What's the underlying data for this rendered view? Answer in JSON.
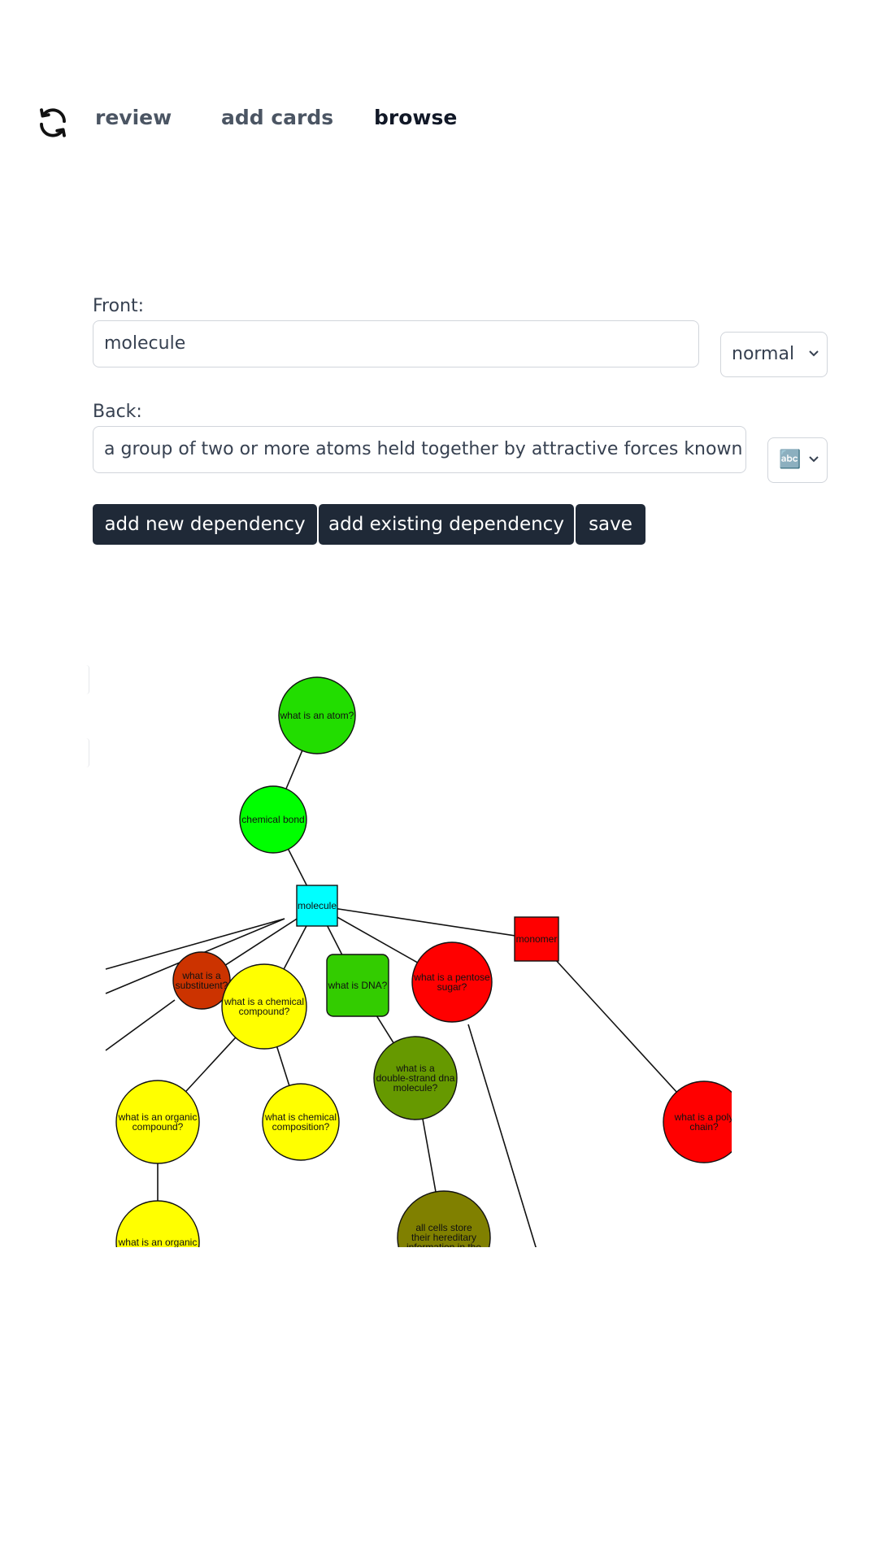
{
  "nav": {
    "refresh_icon": "refresh-icon",
    "links": [
      {
        "label": "review",
        "active": false
      },
      {
        "label": "add cards",
        "active": false
      },
      {
        "label": "browse",
        "active": true
      }
    ]
  },
  "editor": {
    "front_label": "Front:",
    "front_value": "molecule",
    "front_mode": "normal",
    "back_label": "Back:",
    "back_value": "a group of two or more atoms held together by attractive forces known as chemical bonds",
    "back_mode_icon": "🔤"
  },
  "actions": {
    "add_new_dependency": "add new dependency",
    "add_existing_dependency": "add existing dependency",
    "save": "save"
  },
  "graph": {
    "nodes": [
      {
        "id": "atom",
        "label": [
          "what is an atom?"
        ],
        "color": "#22dd00"
      },
      {
        "id": "bond",
        "label": [
          "chemical bond"
        ],
        "color": "#00ff00"
      },
      {
        "id": "molecule",
        "label": [
          "molecule"
        ],
        "color": "#00ffff"
      },
      {
        "id": "monomer",
        "label": [
          "monomer"
        ],
        "color": "#ff0000"
      },
      {
        "id": "substituent",
        "label": [
          "what is a",
          "substituent?"
        ],
        "color": "#cc3300"
      },
      {
        "id": "compound",
        "label": [
          "what is a chemical",
          "compound?"
        ],
        "color": "#ffff00"
      },
      {
        "id": "dna",
        "label": [
          "what is DNA?"
        ],
        "color": "#33cc00"
      },
      {
        "id": "pentose",
        "label": [
          "what is a pentose",
          "sugar?"
        ],
        "color": "#ff0000"
      },
      {
        "id": "dsdna",
        "label": [
          "what is a",
          "double-strand dna",
          "molecule?"
        ],
        "color": "#669900"
      },
      {
        "id": "organic1",
        "label": [
          "what is an organic",
          "compound?"
        ],
        "color": "#ffff00"
      },
      {
        "id": "composition",
        "label": [
          "what is chemical",
          "composition?"
        ],
        "color": "#ffff00"
      },
      {
        "id": "polychain",
        "label": [
          "what is a poly",
          "chain?"
        ],
        "color": "#ff0000"
      },
      {
        "id": "organic2",
        "label": [
          "what is an organic"
        ],
        "color": "#ffff00"
      },
      {
        "id": "cells",
        "label": [
          "all cells store",
          "their hereditary",
          "information in the"
        ],
        "color": "#808000"
      }
    ],
    "edges": [
      [
        "atom",
        "bond"
      ],
      [
        "bond",
        "molecule"
      ],
      [
        "molecule",
        "monomer"
      ],
      [
        "molecule",
        "substituent"
      ],
      [
        "molecule",
        "compound"
      ],
      [
        "molecule",
        "dna"
      ],
      [
        "molecule",
        "pentose"
      ],
      [
        "dna",
        "dsdna"
      ],
      [
        "compound",
        "organic1"
      ],
      [
        "compound",
        "composition"
      ],
      [
        "organic1",
        "organic2"
      ],
      [
        "dsdna",
        "cells"
      ],
      [
        "monomer",
        "polychain"
      ]
    ]
  }
}
